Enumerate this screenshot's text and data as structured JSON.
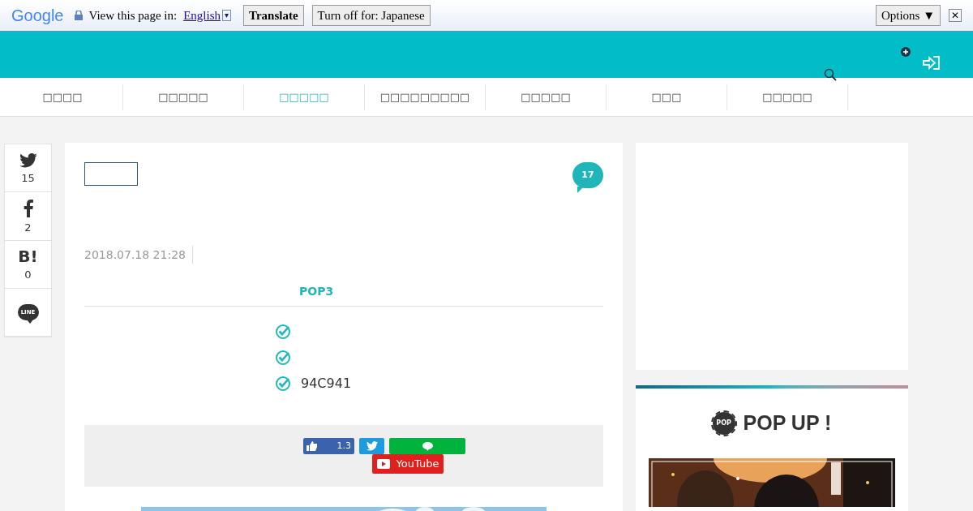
{
  "translate_bar": {
    "logo": "Google",
    "prompt": "View this page in:",
    "language": "English",
    "dropdown_glyph": "▾",
    "translate_button": "Translate",
    "turn_off_button": "Turn off for: Japanese",
    "options_button": "Options ▼",
    "close_glyph": "✕"
  },
  "nav": {
    "items": [
      {
        "label": "□□□□",
        "selected": false
      },
      {
        "label": "□□□□□",
        "selected": false
      },
      {
        "label": "□□□□□",
        "selected": true
      },
      {
        "label": "□□□□□□□□□",
        "selected": false
      },
      {
        "label": "□□□□□",
        "selected": false
      },
      {
        "label": "□□□",
        "selected": false
      },
      {
        "label": "□□□□□",
        "selected": false
      }
    ]
  },
  "share_sidebar": [
    {
      "kind": "twitter",
      "count": "15"
    },
    {
      "kind": "facebook",
      "count": "2"
    },
    {
      "kind": "hatena",
      "icon_text": "B!",
      "count": "0"
    },
    {
      "kind": "line",
      "icon_text": "LINE"
    }
  ],
  "article": {
    "comment_count": "17",
    "date": "2018.07.18 21:28",
    "section_title": "POP3",
    "checklist": [
      {
        "kind": "check"
      },
      {
        "kind": "check"
      },
      {
        "kind": "check",
        "text": "94C941"
      }
    ],
    "share_buttons": {
      "like_count": "1.3",
      "youtube": "YouTube"
    }
  },
  "popup": {
    "badge": "POP",
    "title": "POP UP !"
  }
}
